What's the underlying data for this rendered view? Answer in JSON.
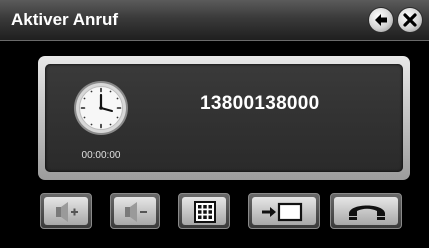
{
  "window": {
    "title": "Aktiver Anruf"
  },
  "header": {
    "back_icon": "back-arrow-icon",
    "close_icon": "close-icon"
  },
  "call": {
    "number": "13800138000",
    "duration": "00:00:00"
  },
  "controls": {
    "volume_up_icon": "speaker-plus-icon",
    "volume_down_icon": "speaker-minus-icon",
    "keypad_icon": "keypad-icon",
    "transfer_icon": "transfer-arrow-icon",
    "hangup_icon": "hangup-handset-icon"
  },
  "colors": {
    "background": "#000000",
    "panel": "#2e2e2e",
    "button_face": "#d0d0d0",
    "text": "#ffffff"
  }
}
